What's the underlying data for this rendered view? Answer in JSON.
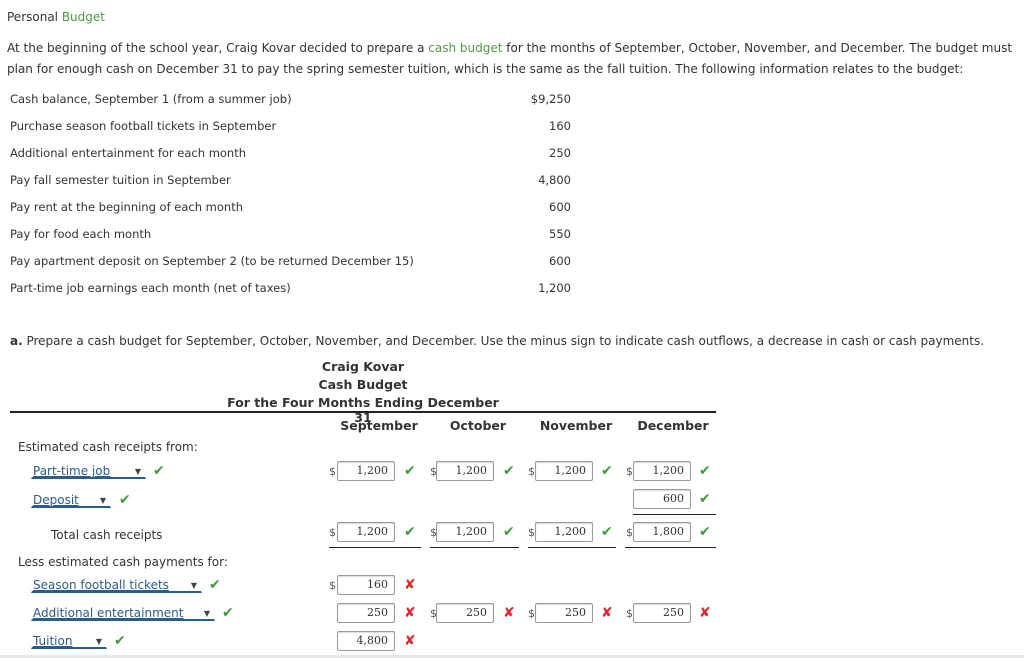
{
  "title": {
    "prefix": "Personal ",
    "link": "Budget"
  },
  "intro": {
    "part1": "At the beginning of the school year, Craig Kovar decided to prepare a ",
    "link": "cash budget",
    "part2": " for the months of September, October, November, and December. The budget must plan for enough cash on December 31 to pay the spring semester tuition, which is the same as the fall tuition. The following information relates to the budget:"
  },
  "info": [
    {
      "label": "Cash balance, September 1 (from a summer job)",
      "value": "$9,250"
    },
    {
      "label": "Purchase season football tickets in September",
      "value": "160"
    },
    {
      "label": "Additional entertainment for each month",
      "value": "250"
    },
    {
      "label": "Pay fall semester tuition in September",
      "value": "4,800"
    },
    {
      "label": "Pay rent at the beginning of each month",
      "value": "600"
    },
    {
      "label": "Pay for food each month",
      "value": "550"
    },
    {
      "label": "Pay apartment deposit on September 2 (to be returned December 15)",
      "value": "600"
    },
    {
      "label": "Part-time job earnings each month (net of taxes)",
      "value": "1,200"
    }
  ],
  "instruction": {
    "letter": "a.",
    "text": " Prepare a cash budget for September, October, November, and December. Use the minus sign to indicate cash outflows, a decrease in cash or cash payments."
  },
  "budget": {
    "header": [
      "Craig Kovar",
      "Cash Budget",
      "For the Four Months Ending December 31"
    ],
    "columns": [
      "September",
      "October",
      "November",
      "December"
    ],
    "receipts_label": "Estimated cash receipts from:",
    "total_receipts_label": "Total cash receipts",
    "payments_label": "Less estimated cash payments for:",
    "currency": "$",
    "status_colors": {
      "correct": "#3d9a3a",
      "incorrect": "#e2262b"
    },
    "rows": {
      "part_time_job": {
        "select": "Part-time job",
        "select_status": "correct",
        "values": [
          "1,200",
          "1,200",
          "1,200",
          "1,200"
        ],
        "status": [
          "correct",
          "correct",
          "correct",
          "correct"
        ]
      },
      "deposit": {
        "select": "Deposit",
        "select_status": "correct",
        "values": [
          "",
          "",
          "",
          "600"
        ],
        "status": [
          "",
          "",
          "",
          "correct"
        ]
      },
      "total_receipts": {
        "values": [
          "1,200",
          "1,200",
          "1,200",
          "1,800"
        ],
        "status": [
          "correct",
          "correct",
          "correct",
          "correct"
        ]
      },
      "football_tickets": {
        "select": "Season football tickets",
        "select_status": "correct",
        "values": [
          "160",
          "",
          "",
          ""
        ],
        "status": [
          "incorrect",
          "",
          "",
          ""
        ]
      },
      "entertainment": {
        "select": "Additional entertainment",
        "select_status": "correct",
        "values": [
          "250",
          "250",
          "250",
          "250"
        ],
        "status": [
          "incorrect",
          "incorrect",
          "incorrect",
          "incorrect"
        ]
      },
      "tuition": {
        "select": "Tuition",
        "select_status": "correct",
        "values": [
          "4,800",
          "",
          "",
          ""
        ],
        "status": [
          "incorrect",
          "",
          "",
          ""
        ]
      }
    }
  },
  "icons": {
    "check": "✔",
    "cross": "✘",
    "caret": "▼"
  }
}
